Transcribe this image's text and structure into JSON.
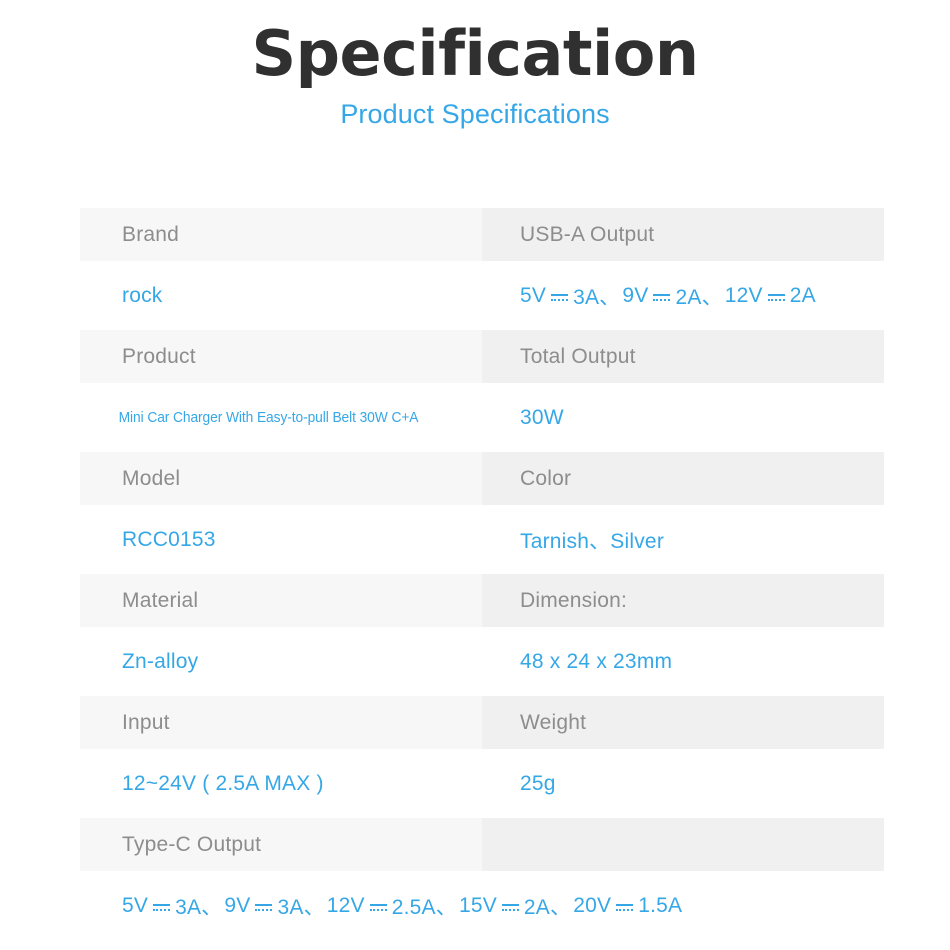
{
  "header": {
    "title": "Specification",
    "subtitle": "Product Specifications"
  },
  "colors": {
    "accent_blue": "#36a7e6",
    "title_dark": "#303030",
    "label_gray_text": "#8d8d8d",
    "label_band_left": "#f7f7f7",
    "label_band_right": "#f0f0f0",
    "page_background": "#ffffff"
  },
  "spec_table": {
    "blocks": [
      {
        "labels": {
          "left": "Brand",
          "right": "USB-A Output"
        },
        "values": {
          "left": "rock",
          "left_style": "normal",
          "right_parts": [
            "5V",
            "DC",
            "3A、",
            "9V",
            "DC",
            "2A、",
            "12V",
            "DC",
            "2A"
          ],
          "right_text": "5V ⎓ 3A、9V ⎓ 2A、12V ⎓ 2A"
        }
      },
      {
        "labels": {
          "left": "Product",
          "right": "Total Output"
        },
        "values": {
          "left": "Mini Car Charger With Easy-to-pull Belt 30W C+A",
          "left_style": "compact",
          "right_text": "30W"
        }
      },
      {
        "labels": {
          "left": "Model",
          "right": "Color"
        },
        "values": {
          "left": "RCC0153",
          "left_style": "normal",
          "right_text": "Tarnish、Silver"
        }
      },
      {
        "labels": {
          "left": "Material",
          "right": "Dimension:"
        },
        "values": {
          "left": "Zn-alloy",
          "left_style": "normal",
          "right_text": "48 x 24 x 23mm"
        }
      },
      {
        "labels": {
          "left": "Input",
          "right": "Weight"
        },
        "values": {
          "left": "12~24V ( 2.5A MAX )",
          "left_style": "normal",
          "right_text": "25g"
        }
      },
      {
        "labels": {
          "left": "Type-C Output",
          "right": ""
        },
        "values": {
          "left_parts": [
            "5V",
            "DC",
            "3A、",
            "9V",
            "DC",
            "3A、",
            "12V",
            "DC",
            "2.5A、",
            "15V",
            "DC",
            "2A、",
            "20V",
            "DC",
            "1.5A"
          ],
          "left_text": "5V ⎓ 3A、9V ⎓ 3A、12V ⎓ 2.5A、15V ⎓ 2A、20V ⎓ 1.5A",
          "left_style": "normal",
          "right_text": ""
        }
      }
    ],
    "usb_a_segments": [
      {
        "v": "5V",
        "a": "3A、"
      },
      {
        "v": "9V",
        "a": "2A、"
      },
      {
        "v": "12V",
        "a": "2A"
      }
    ],
    "type_c_segments": [
      {
        "v": "5V",
        "a": "3A、"
      },
      {
        "v": "9V",
        "a": "3A、"
      },
      {
        "v": "12V",
        "a": "2.5A、"
      },
      {
        "v": "15V",
        "a": "2A、"
      },
      {
        "v": "20V",
        "a": "1.5A"
      }
    ]
  }
}
